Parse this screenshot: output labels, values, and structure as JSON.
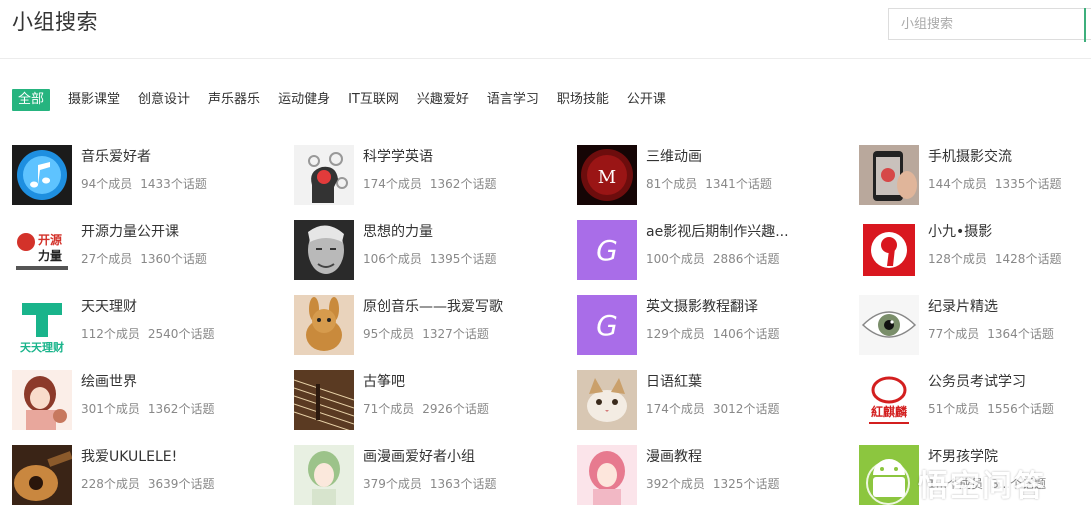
{
  "header": {
    "title": "小组搜索",
    "search_placeholder": "小组搜索"
  },
  "categories": [
    "全部",
    "摄影课堂",
    "创意设计",
    "声乐器乐",
    "运动健身",
    "IT互联网",
    "兴趣爱好",
    "语言学习",
    "职场技能",
    "公开课"
  ],
  "groups": [
    {
      "name": "音乐爱好者",
      "members": "94个成员",
      "topics": "1433个话题",
      "icon": "itunes-icon"
    },
    {
      "name": "科学学英语",
      "members": "174个成员",
      "topics": "1362个话题",
      "icon": "brain-gears-icon"
    },
    {
      "name": "三维动画",
      "members": "81个成员",
      "topics": "1341个话题",
      "icon": "maya-logo-icon"
    },
    {
      "name": "手机摄影交流",
      "members": "144个成员",
      "topics": "1335个话题",
      "icon": "phone-camera-photo"
    },
    {
      "name": "开源力量公开课",
      "members": "27个成员",
      "topics": "1360个话题",
      "icon": "open-source-force-logo"
    },
    {
      "name": "思想的力量",
      "members": "106个成员",
      "topics": "1395个话题",
      "icon": "old-man-portrait"
    },
    {
      "name": "ae影视后期制作兴趣...",
      "members": "100个成员",
      "topics": "2886个话题",
      "icon": "g-letter-icon"
    },
    {
      "name": "小九•摄影",
      "members": "128个成员",
      "topics": "1428个话题",
      "icon": "nine-logo-icon"
    },
    {
      "name": "天天理财",
      "members": "112个成员",
      "topics": "2540个话题",
      "icon": "tiantian-licai-logo"
    },
    {
      "name": "原创音乐——我爱写歌",
      "members": "95个成员",
      "topics": "1327个话题",
      "icon": "plush-toy-photo"
    },
    {
      "name": "英文摄影教程翻译",
      "members": "129个成员",
      "topics": "1406个话题",
      "icon": "g-letter-icon"
    },
    {
      "name": "纪录片精选",
      "members": "77个成员",
      "topics": "1364个话题",
      "icon": "eye-photo"
    },
    {
      "name": "绘画世界",
      "members": "301个成员",
      "topics": "1362个话题",
      "icon": "anime-girl-illustration"
    },
    {
      "name": "古筝吧",
      "members": "71个成员",
      "topics": "2926个话题",
      "icon": "guzheng-strings-photo"
    },
    {
      "name": "日语紅葉",
      "members": "174个成员",
      "topics": "3012个话题",
      "icon": "cat-photo"
    },
    {
      "name": "公务员考试学习",
      "members": "51个成员",
      "topics": "1556个话题",
      "icon": "seal-logo-icon"
    },
    {
      "name": "我爱UKULELE!",
      "members": "228个成员",
      "topics": "3639个话题",
      "icon": "ukulele-photo"
    },
    {
      "name": "画漫画爱好者小组",
      "members": "379个成员",
      "topics": "1363个话题",
      "icon": "anime-boy-illustration"
    },
    {
      "name": "漫画教程",
      "members": "392个成员",
      "topics": "1325个话题",
      "icon": "anime-girl-pink-illustration"
    },
    {
      "name": "坏男孩学院",
      "members": "1...个成员",
      "topics": "3...个话题",
      "icon": "android-logo-icon"
    }
  ],
  "watermark": {
    "text": "悟空问答"
  },
  "colors": {
    "accent": "#26b47f",
    "text": "#333333",
    "meta": "#888888"
  }
}
